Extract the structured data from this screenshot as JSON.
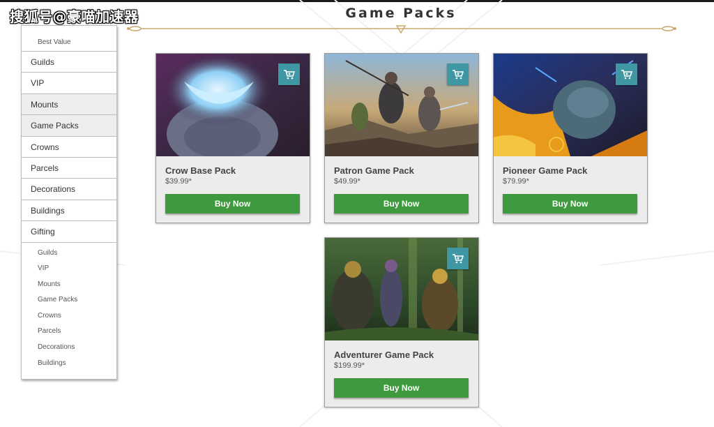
{
  "watermark": "搜狐号@豪喵加速器",
  "page_title": "Game Packs",
  "sidebar": {
    "top_sub": "Best Value",
    "items": [
      {
        "label": "Guilds"
      },
      {
        "label": "VIP"
      },
      {
        "label": "Mounts"
      },
      {
        "label": "Game Packs"
      },
      {
        "label": "Crowns"
      },
      {
        "label": "Parcels"
      },
      {
        "label": "Decorations"
      },
      {
        "label": "Buildings"
      },
      {
        "label": "Gifting"
      }
    ],
    "gifting_sub": [
      {
        "label": "Guilds"
      },
      {
        "label": "VIP"
      },
      {
        "label": "Mounts"
      },
      {
        "label": "Game Packs"
      },
      {
        "label": "Crowns"
      },
      {
        "label": "Parcels"
      },
      {
        "label": "Decorations"
      },
      {
        "label": "Buildings"
      }
    ]
  },
  "products": [
    {
      "name": "Crow Base Pack",
      "price": "$39.99*",
      "button": "Buy Now"
    },
    {
      "name": "Patron Game Pack",
      "price": "$49.99*",
      "button": "Buy Now"
    },
    {
      "name": "Pioneer Game Pack",
      "price": "$79.99*",
      "button": "Buy Now"
    },
    {
      "name": "Adventurer Game Pack",
      "price": "$199.99*",
      "button": "Buy Now"
    }
  ],
  "colors": {
    "buy_button": "#3f9a3f",
    "cart_button": "#3e97a2",
    "title_rule": "#c9a96e"
  },
  "icons": {
    "cart": "shopping-cart-icon"
  }
}
